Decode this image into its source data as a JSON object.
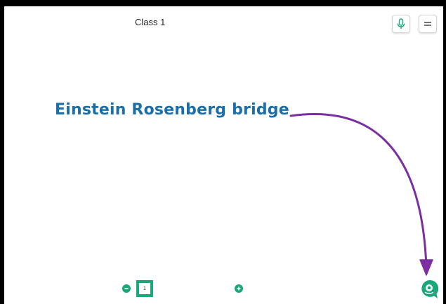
{
  "header": {
    "class_title": "Class 1"
  },
  "toolbar": {
    "mic_icon": "microphone-icon",
    "menu_icon": "hamburger-menu-icon"
  },
  "canvas": {
    "annotation_text": "Einstein Rosenberg bridge",
    "annotation_color": "#1c6ea8",
    "arrow_color": "#7b2fa0"
  },
  "pager": {
    "zoom_out_icon": "minus-circle-icon",
    "zoom_in_icon": "plus-circle-icon",
    "current_page": "1",
    "accent_color": "#1aa77a"
  },
  "chat": {
    "icon": "chat-bubble-icon"
  }
}
